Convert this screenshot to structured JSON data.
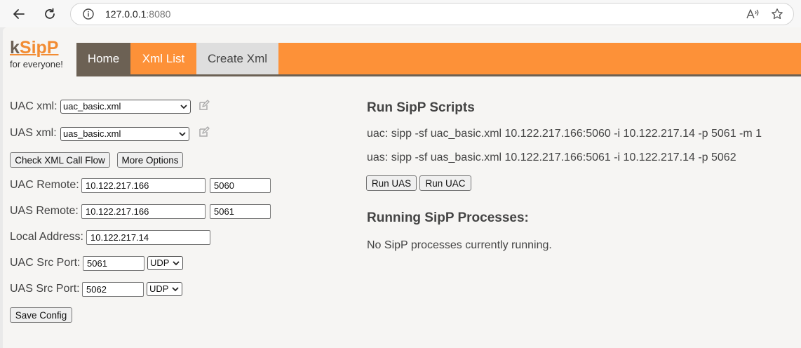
{
  "browser": {
    "url_host": "127.0.0.1",
    "url_port": ":8080"
  },
  "brand": {
    "logo_k": "k",
    "logo_rest": "SipP",
    "tagline": "for everyone!"
  },
  "menu": {
    "tabs": [
      "Home",
      "Xml List",
      "Create Xml"
    ],
    "active": "Home"
  },
  "form": {
    "uac_xml_label": "UAC xml:",
    "uac_xml_value": "uac_basic.xml",
    "uas_xml_label": "UAS xml:",
    "uas_xml_value": "uas_basic.xml",
    "check_flow_button": "Check XML Call Flow",
    "more_options_button": "More Options",
    "uac_remote_label": "UAC Remote:",
    "uac_remote_ip": "10.122.217.166",
    "uac_remote_port": "5060",
    "uas_remote_label": "UAS Remote:",
    "uas_remote_ip": "10.122.217.166",
    "uas_remote_port": "5061",
    "local_address_label": "Local Address:",
    "local_address_value": "10.122.217.14",
    "uac_src_port_label": "UAC Src Port:",
    "uac_src_port_value": "5061",
    "uac_transport": "UDP",
    "uas_src_port_label": "UAS Src Port:",
    "uas_src_port_value": "5062",
    "uas_transport": "UDP",
    "save_button": "Save Config"
  },
  "run": {
    "heading": "Run SipP Scripts",
    "uac_cmd": "uac: sipp -sf uac_basic.xml 10.122.217.166:5060 -i 10.122.217.14 -p 5061 -m 1",
    "uas_cmd": "uas: sipp -sf uas_basic.xml 10.122.217.166:5061 -i 10.122.217.14 -p 5062",
    "run_uas_button": "Run UAS",
    "run_uac_button": "Run UAC"
  },
  "processes": {
    "heading": "Running SipP Processes:",
    "status": "No SipP processes currently running."
  },
  "colors": {
    "accent": "#fd9138",
    "active_tab": "#6c6154",
    "inactive_tab": "#dedede"
  }
}
